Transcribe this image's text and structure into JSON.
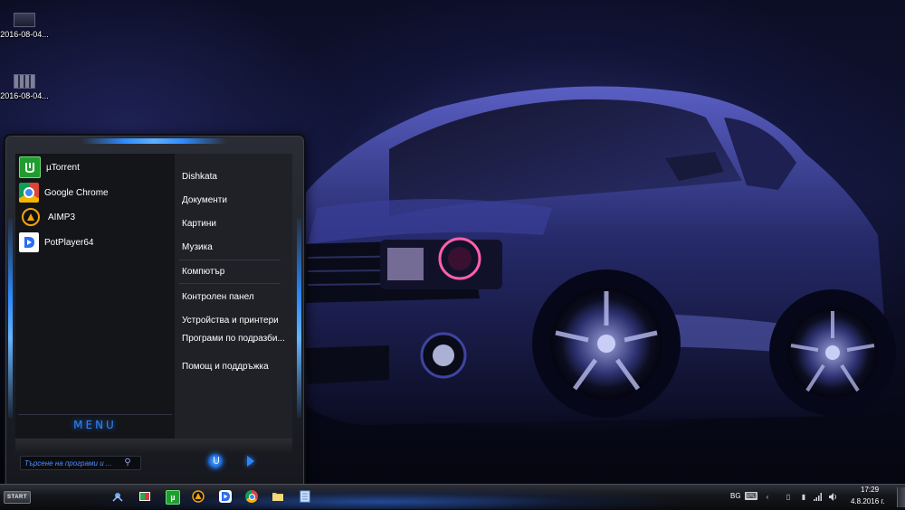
{
  "desktop": {
    "icons": [
      {
        "label": "2016-08-04...",
        "icon": "image-thumbnail-icon"
      },
      {
        "label": "2016-08-04...",
        "icon": "image-thumbnail-icon"
      }
    ]
  },
  "start_menu": {
    "programs": [
      {
        "label": "µTorrent",
        "icon": "utorrent-icon",
        "color": "#1f9e2f"
      },
      {
        "label": "Google Chrome",
        "icon": "chrome-icon",
        "color": "#4285f4"
      },
      {
        "label": "AIMP3",
        "icon": "aimp-icon",
        "color": "#f2a50c"
      },
      {
        "label": "PotPlayer64",
        "icon": "potplayer-icon",
        "color": "#2a6df4"
      }
    ],
    "menu_label": "MENU",
    "links": [
      {
        "label": "Dishkata"
      },
      {
        "label": "Документи"
      },
      {
        "label": "Картини"
      },
      {
        "label": "Музика"
      },
      {
        "label": "Компютър"
      },
      {
        "label": "Контролен панел"
      },
      {
        "label": "Устройства и принтери"
      },
      {
        "label": "Програми по подразби..."
      },
      {
        "label": "Помощ и поддръжка"
      }
    ],
    "search": {
      "placeholder": "Търсене на програми и ..."
    },
    "accent_color": "#2a86ff"
  },
  "taskbar": {
    "start_label": "START",
    "pinned": [
      {
        "name": "explorer-pin",
        "icon": "windows-explorer-icon"
      },
      {
        "name": "media-pin",
        "icon": "media-player-icon"
      },
      {
        "name": "utorrent-pin",
        "icon": "utorrent-icon"
      },
      {
        "name": "aimp-pin",
        "icon": "aimp-icon"
      },
      {
        "name": "potplayer-pin",
        "icon": "potplayer-icon"
      },
      {
        "name": "chrome-pin",
        "icon": "chrome-icon"
      },
      {
        "name": "folder-pin",
        "icon": "folder-icon"
      },
      {
        "name": "notepad-pin",
        "icon": "notepad-icon"
      }
    ],
    "tray": {
      "language": "BG",
      "time": "17:29",
      "date": "4.8.2016 г."
    }
  }
}
